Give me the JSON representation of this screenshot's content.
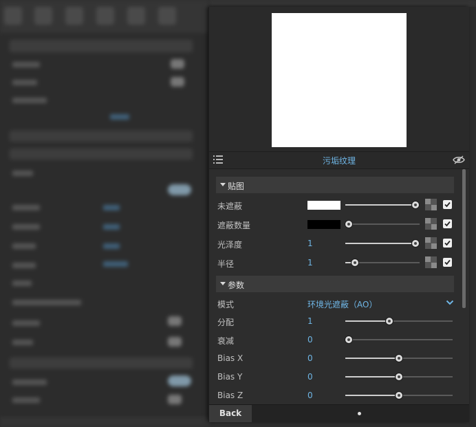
{
  "panel": {
    "title": "污垢纹理",
    "sections": [
      {
        "label": "贴图",
        "rows": [
          {
            "name": "未遮蔽",
            "type": "color",
            "color": "#ffffff",
            "slider": 0.94,
            "checked": true
          },
          {
            "name": "遮蔽数量",
            "type": "color",
            "color": "#000000",
            "slider": 0.05,
            "checked": true
          },
          {
            "name": "光泽度",
            "type": "number",
            "value": "1",
            "slider": 0.94,
            "checked": true
          },
          {
            "name": "半径",
            "type": "number",
            "value": "1",
            "slider": 0.13,
            "checked": true
          }
        ]
      },
      {
        "label": "参数",
        "rows": [
          {
            "name": "模式",
            "type": "dropdown",
            "value": "环境光遮蔽（AO）"
          },
          {
            "name": "分配",
            "type": "number",
            "value": "1",
            "slider": 0.41
          },
          {
            "name": "衰减",
            "type": "number",
            "value": "0",
            "slider": 0.03
          },
          {
            "name": "Bias X",
            "type": "number",
            "value": "0",
            "slider": 0.5
          },
          {
            "name": "Bias Y",
            "type": "number",
            "value": "0",
            "slider": 0.5
          },
          {
            "name": "Bias Z",
            "type": "number",
            "value": "0",
            "slider": 0.5
          }
        ]
      }
    ]
  },
  "bottom": {
    "back_label": "Back"
  },
  "colors": {
    "accent": "#6fb6e6",
    "panel_bg": "#2d2d2d",
    "section_bg": "#3b3b3b"
  },
  "icons": {
    "menu": "list-menu-icon",
    "visibility": "eye-hidden-icon",
    "texture": "checker-texture-icon",
    "dropdown": "chevron-down-icon"
  }
}
